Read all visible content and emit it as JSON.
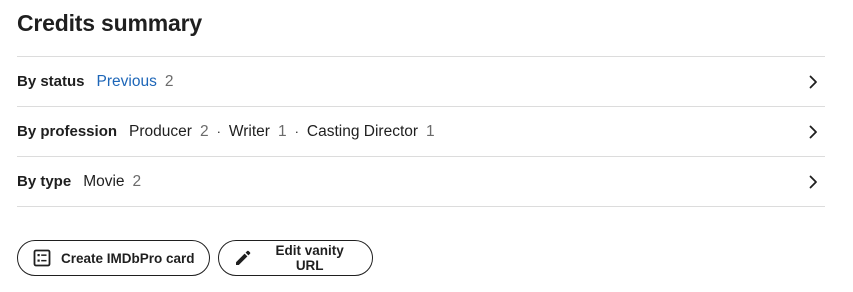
{
  "title": "Credits summary",
  "rows": [
    {
      "label": "By status",
      "items": [
        {
          "text": "Previous",
          "count": "2",
          "link": true
        }
      ]
    },
    {
      "label": "By profession",
      "items": [
        {
          "text": "Producer",
          "count": "2"
        },
        {
          "text": "Writer",
          "count": "1"
        },
        {
          "text": "Casting Director",
          "count": "1"
        }
      ],
      "separator": "·"
    },
    {
      "label": "By type",
      "items": [
        {
          "text": "Movie",
          "count": "2"
        }
      ]
    }
  ],
  "buttons": {
    "create_card": {
      "label": "Create IMDbPro card",
      "icon": "card-list-icon"
    },
    "edit_vanity": {
      "label": "Edit vanity URL",
      "icon": "pencil-icon"
    }
  },
  "colors": {
    "link": "#1d66b8",
    "text": "#1f1f1f",
    "muted": "#6b6b6b",
    "divider": "#dcdcdc"
  }
}
